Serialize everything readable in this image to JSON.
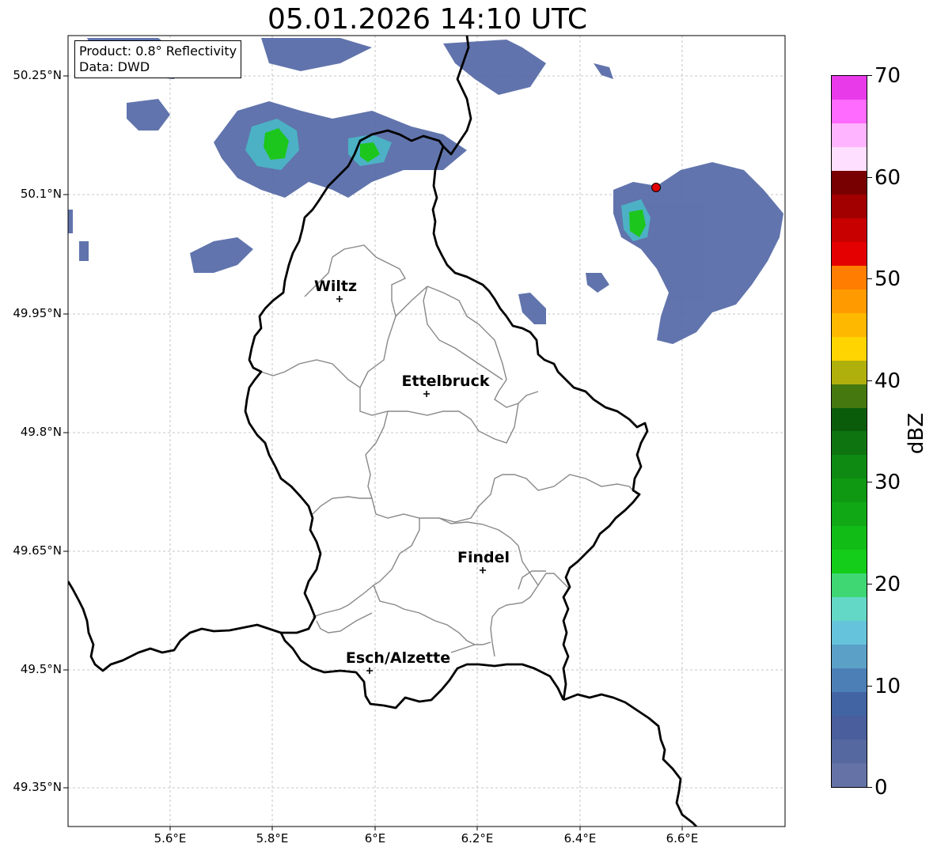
{
  "title": "05.01.2026 14:10 UTC",
  "info": {
    "product": "Product: 0.8° Reflectivity",
    "source": "Data: DWD"
  },
  "lat_labels": [
    "50.25°N",
    "50.1°N",
    "49.95°N",
    "49.8°N",
    "49.65°N",
    "49.5°N",
    "49.35°N"
  ],
  "lon_labels": [
    "5.6°E",
    "5.8°E",
    "6°E",
    "6.2°E",
    "6.4°E",
    "6.6°E"
  ],
  "cities": [
    {
      "name": "Wiltz",
      "lon": 5.93,
      "lat": 49.966
    },
    {
      "name": "Ettelbruck",
      "lon": 6.1,
      "lat": 49.846
    },
    {
      "name": "Findel",
      "lon": 6.21,
      "lat": 49.626
    },
    {
      "name": "Esch/Alzette",
      "lon": 5.99,
      "lat": 49.5
    }
  ],
  "radar_site": {
    "lon": 6.548,
    "lat": 50.11,
    "color": "#e00000"
  },
  "colorbar": {
    "label": "dBZ",
    "ticks": [
      "0",
      "10",
      "20",
      "30",
      "40",
      "50",
      "60",
      "70"
    ],
    "colors": [
      "#6472a6",
      "#55689f",
      "#4a5e9e",
      "#4264a3",
      "#4c7fb5",
      "#5aa0c7",
      "#66c3dc",
      "#63d8c6",
      "#3ed774",
      "#14cc1a",
      "#12bc16",
      "#11a815",
      "#0f9912",
      "#0e8a12",
      "#0d7410",
      "#0a5c0b",
      "#467810",
      "#b0b00c",
      "#ffd400",
      "#ffb800",
      "#ff9b00",
      "#ff7d00",
      "#e40000",
      "#c80000",
      "#a20000",
      "#780000",
      "#ffdfff",
      "#ffb4ff",
      "#ff6aff",
      "#e83ae8"
    ]
  },
  "map_extent": {
    "lon_min": 5.4,
    "lon_max": 6.8,
    "lat_min": 49.3,
    "lat_max": 50.3
  },
  "echo_colors": {
    "weak": "#5468a6",
    "moderate": "#4ab8c8",
    "strong": "#1cc61c"
  }
}
